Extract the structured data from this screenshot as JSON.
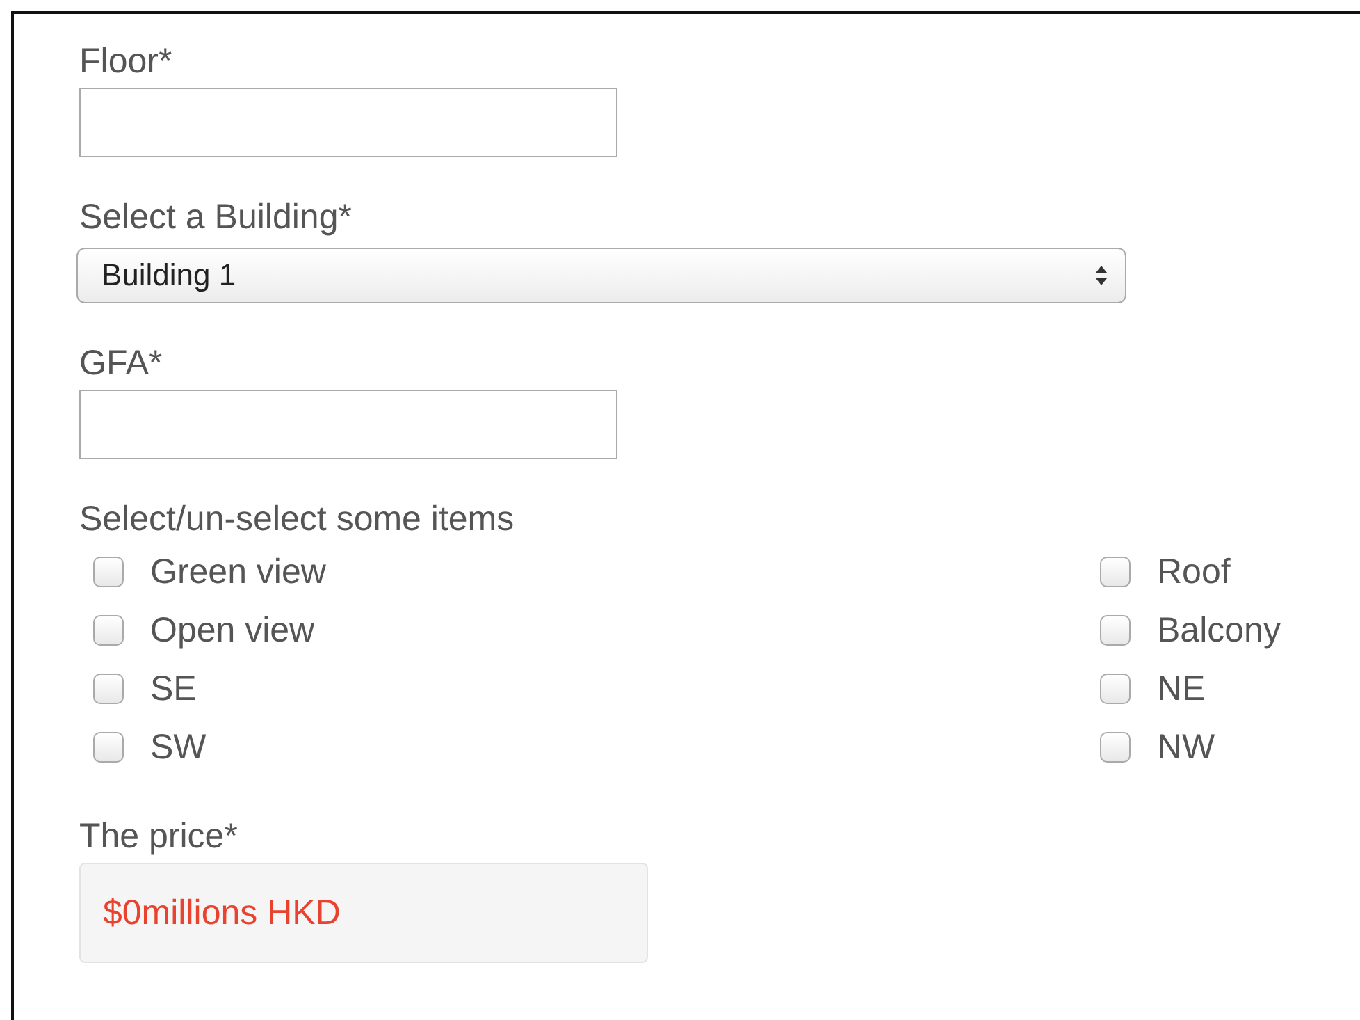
{
  "form": [
    {
      "kind": "text",
      "label": "Floor*"
    },
    {
      "kind": "select",
      "label": "Select a Building*",
      "value": "Building 1"
    },
    {
      "kind": "text",
      "label": "GFA*"
    },
    {
      "kind": "checkgroup",
      "label": "Select/un-select some items",
      "columns": [
        [
          {
            "label": "Green view",
            "checked": false
          },
          {
            "label": "Open view",
            "checked": false
          },
          {
            "label": "SE",
            "checked": false
          },
          {
            "label": "SW",
            "checked": false
          }
        ],
        [
          {
            "label": "Roof",
            "checked": false
          },
          {
            "label": "Balcony",
            "checked": false
          },
          {
            "label": "NE",
            "checked": false
          },
          {
            "label": "NW",
            "checked": false
          }
        ]
      ]
    },
    {
      "kind": "output",
      "label": "The price*",
      "value": "$0millions HKD"
    }
  ]
}
